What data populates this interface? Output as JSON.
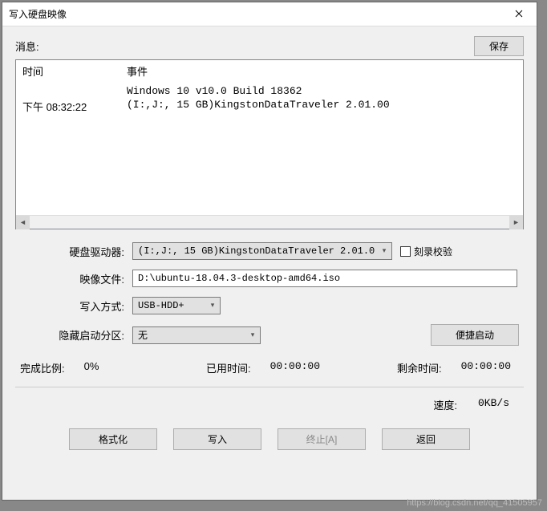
{
  "window": {
    "title": "写入硬盘映像"
  },
  "message": {
    "label": "消息:",
    "save_btn": "保存",
    "columns": {
      "time": "时间",
      "event": "事件"
    },
    "rows": [
      {
        "time": "",
        "event": "Windows 10 v10.0 Build 18362"
      },
      {
        "time": "下午 08:32:22",
        "event": "(I:,J:, 15 GB)KingstonDataTraveler 2.01.00"
      }
    ]
  },
  "form": {
    "drive_label": "硬盘驱动器:",
    "drive_value": "(I:,J:, 15 GB)KingstonDataTraveler 2.01.0",
    "verify_label": "刻录校验",
    "image_label": "映像文件:",
    "image_value": "D:\\ubuntu-18.04.3-desktop-amd64.iso",
    "write_method_label": "写入方式:",
    "write_method_value": "USB-HDD+",
    "hide_partition_label": "隐藏启动分区:",
    "hide_partition_value": "无",
    "quick_boot_btn": "便捷启动"
  },
  "status": {
    "progress_label": "完成比例:",
    "progress_value": "0%",
    "elapsed_label": "已用时间:",
    "elapsed_value": "00:00:00",
    "remaining_label": "剩余时间:",
    "remaining_value": "00:00:00",
    "speed_label": "速度:",
    "speed_value": "0KB/s"
  },
  "buttons": {
    "format": "格式化",
    "write": "写入",
    "stop": "终止[A]",
    "return": "返回"
  },
  "watermark": "https://blog.csdn.net/qq_41505957"
}
